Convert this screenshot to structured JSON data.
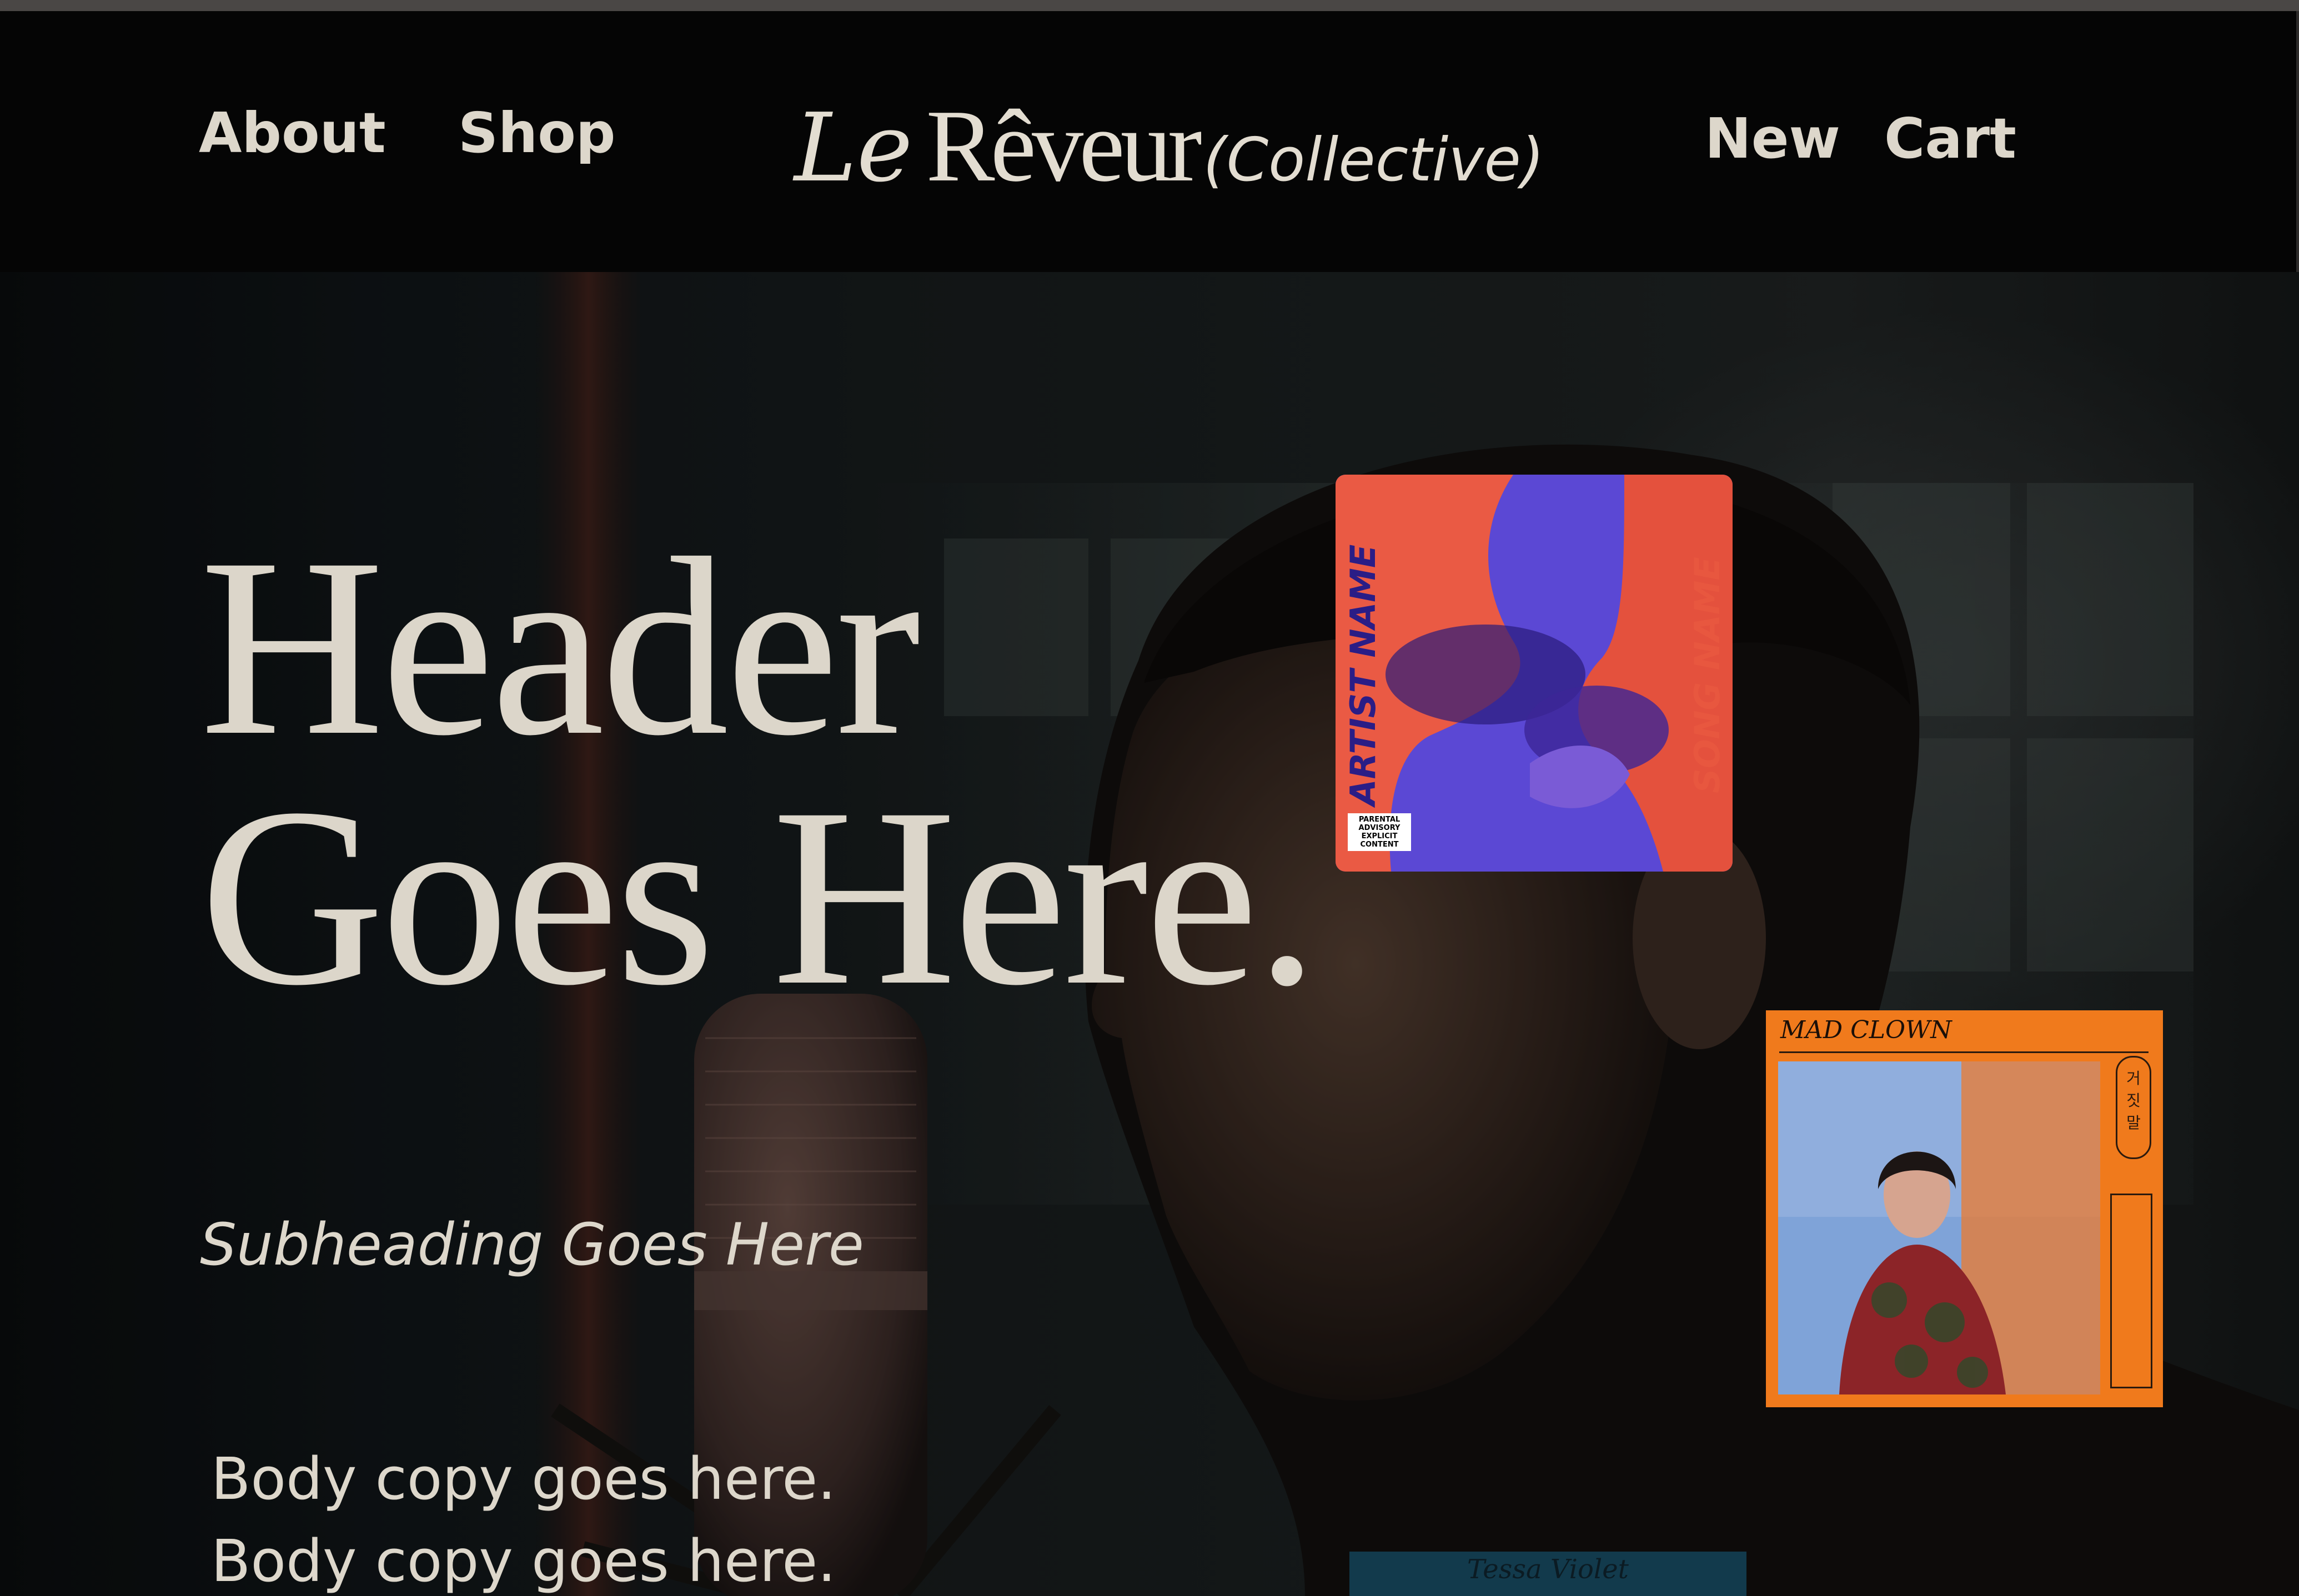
{
  "nav": {
    "left": [
      "About",
      "Shop"
    ],
    "right": [
      "New",
      "Cart"
    ]
  },
  "logo": {
    "le": "Le",
    "reveur": "Rêveur",
    "collective": "(Collective)"
  },
  "hero": {
    "headline_lines": [
      "Header",
      "Goes Here."
    ],
    "subheading": "Subheading Goes Here",
    "body_lines": [
      "Body copy goes here.",
      "Body copy goes here."
    ]
  },
  "albums": [
    {
      "artist": "ARTIST NAME",
      "song": "SONG NAME",
      "advisory": "PARENTAL ADVISORY EXPLICIT CONTENT",
      "colors": {
        "bg": "#5a4bd6",
        "accent": "#e8573f"
      }
    },
    {
      "title": "MAD CLOWN",
      "badge": "거짓말",
      "colors": {
        "bg": "#f07a1c",
        "photo": "#7fa3d8"
      }
    },
    {
      "title": "Tessa Violet",
      "colors": {
        "bg": "#123a4c"
      }
    }
  ],
  "colors": {
    "text": "#ddd7cb",
    "navbar": "#050505",
    "topbar": "#4a4745"
  }
}
